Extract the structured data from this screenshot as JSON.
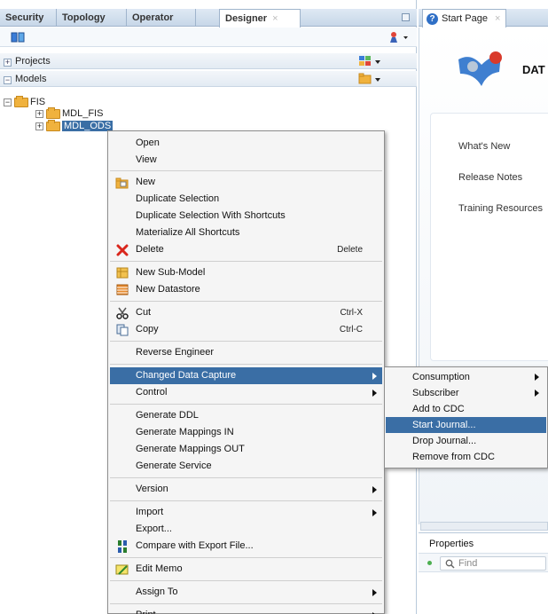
{
  "left_tabs": [
    "Security",
    "Topology",
    "Operator",
    "Designer"
  ],
  "left_tab_close": "×",
  "sections": {
    "projects": {
      "expander": "+",
      "label": "Projects"
    },
    "models": {
      "expander": "−",
      "label": "Models"
    }
  },
  "tree": {
    "root": {
      "expander": "−",
      "label": "FIS"
    },
    "children": [
      {
        "expander": "+",
        "label": "MDL_FIS"
      },
      {
        "expander": "+",
        "label": "MDL_ODS"
      }
    ]
  },
  "right_tab": {
    "icon": "?",
    "label": "Start Page",
    "close": "×"
  },
  "start_page": {
    "title": "DAT",
    "links": [
      "What's New",
      "Release Notes",
      "Training Resources"
    ]
  },
  "properties": {
    "title": "Properties",
    "find_placeholder": "Find"
  },
  "context_menu": {
    "open": "Open",
    "view": "View",
    "new": "New",
    "duplicate_selection": "Duplicate Selection",
    "duplicate_with_shortcuts": "Duplicate Selection With Shortcuts",
    "materialize_shortcuts": "Materialize All Shortcuts",
    "delete": "Delete",
    "delete_shortcut": "Delete",
    "new_submodel": "New Sub-Model",
    "new_datastore": "New Datastore",
    "cut": "Cut",
    "cut_shortcut": "Ctrl-X",
    "copy": "Copy",
    "copy_shortcut": "Ctrl-C",
    "reverse_engineer": "Reverse Engineer",
    "changed_data_capture": "Changed Data Capture",
    "control": "Control",
    "generate_ddl": "Generate DDL",
    "generate_mappings_in": "Generate Mappings IN",
    "generate_mappings_out": "Generate Mappings OUT",
    "generate_service": "Generate Service",
    "version": "Version",
    "import": "Import",
    "export": "Export...",
    "compare_export": "Compare with Export File...",
    "edit_memo": "Edit Memo",
    "assign_to": "Assign To",
    "print": "Print"
  },
  "cdc_submenu": {
    "consumption": "Consumption",
    "subscriber": "Subscriber",
    "add_to_cdc": "Add to CDC",
    "start_journal": "Start Journal...",
    "drop_journal": "Drop Journal...",
    "remove_from_cdc": "Remove from CDC"
  },
  "icons": {
    "new": "new-folder-icon",
    "delete": "delete-x-icon",
    "new_submodel": "submodel-icon",
    "new_datastore": "datastore-icon",
    "cut": "scissors-icon",
    "copy": "copy-icon",
    "compare": "compare-icon",
    "memo": "memo-icon"
  },
  "colors": {
    "selection": "#3a6ea5",
    "delete_red": "#d9261c",
    "folder": "#f0b23e"
  }
}
